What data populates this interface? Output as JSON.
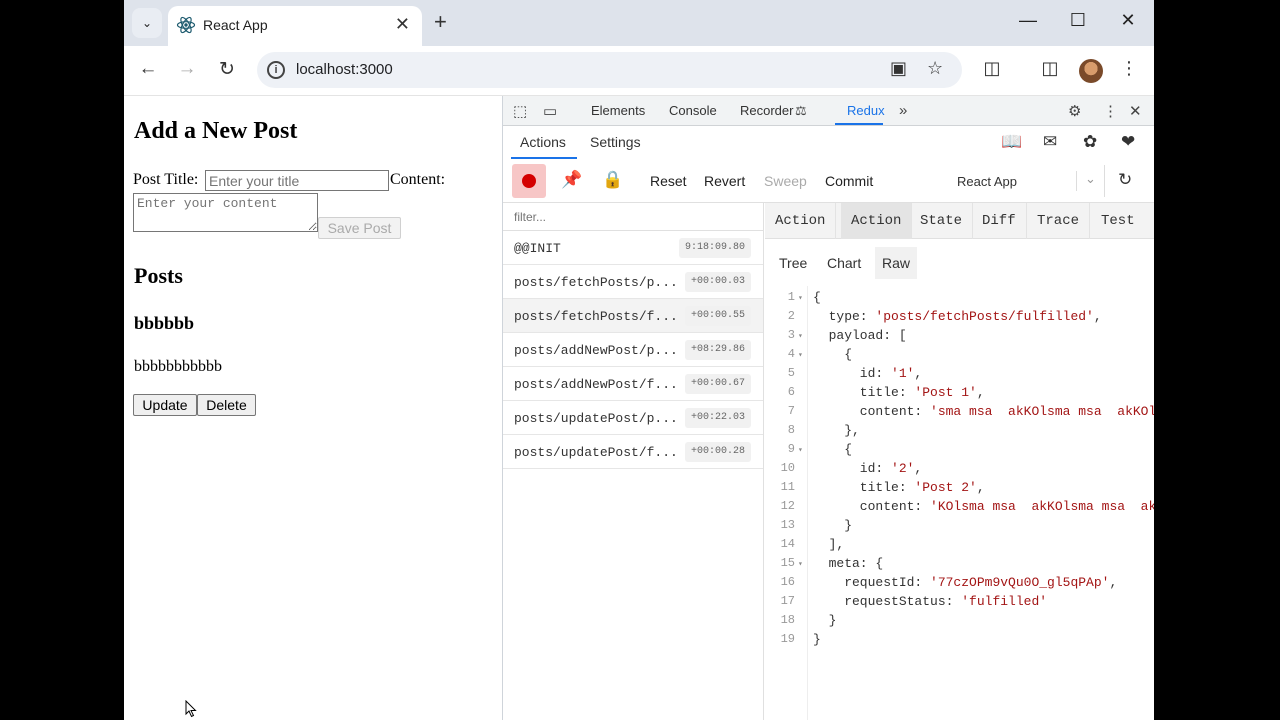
{
  "browser": {
    "tab_title": "React App",
    "url": "localhost:3000",
    "new_tab_glyph": "+",
    "close_tab_glyph": "✕"
  },
  "page": {
    "heading": "Add a New Post",
    "post_title_label": "Post Title:",
    "post_title_placeholder": "Enter your title",
    "content_label": "Content:",
    "content_placeholder": "Enter your content",
    "save_button": "Save Post",
    "posts_heading": "Posts",
    "posts": [
      {
        "title": "bbbbbb",
        "content": "bbbbbbbbbbb"
      }
    ],
    "update_button": "Update",
    "delete_button": "Delete"
  },
  "devtools": {
    "tabs": [
      "Elements",
      "Console",
      "Recorder",
      "Redux"
    ],
    "active_tab": "Redux"
  },
  "redux": {
    "subtabs": [
      "Actions",
      "Settings"
    ],
    "toolbar": {
      "reset": "Reset",
      "revert": "Revert",
      "sweep": "Sweep",
      "commit": "Commit",
      "instance": "React App"
    },
    "filter_placeholder": "filter...",
    "actions": [
      {
        "name": "@@INIT",
        "time": "9:18:09.80"
      },
      {
        "name": "posts/fetchPosts/p...",
        "time": "+00:00.03"
      },
      {
        "name": "posts/fetchPosts/f...",
        "time": "+00:00.55",
        "selected": true
      },
      {
        "name": "posts/addNewPost/p...",
        "time": "+08:29.86"
      },
      {
        "name": "posts/addNewPost/f...",
        "time": "+00:00.67"
      },
      {
        "name": "posts/updatePost/p...",
        "time": "+00:22.03"
      },
      {
        "name": "posts/updatePost/f...",
        "time": "+00:00.28"
      }
    ],
    "inspector_tabs": [
      "Action",
      "Action",
      "State",
      "Diff",
      "Trace",
      "Test"
    ],
    "active_inspector_tab": 1,
    "view_tabs": [
      "Tree",
      "Chart",
      "Raw"
    ],
    "active_view_tab": "Raw",
    "raw_lines": [
      "{",
      "  type: 'posts/fetchPosts/fulfilled',",
      "  payload: [",
      "    {",
      "      id: '1',",
      "      title: 'Post 1',",
      "      content: 'sma msa  akKOlsma msa  akKOlsma msa  akKOl",
      "    },",
      "    {",
      "      id: '2',",
      "      title: 'Post 2',",
      "      content: 'KOlsma msa  akKOlsma msa  akKOlsma msa",
      "    }",
      "  ],",
      "  meta: {",
      "    requestId: '77czOPm9vQu0O_gl5qPAp',",
      "    requestStatus: 'fulfilled'",
      "  }",
      "}"
    ],
    "fold_lines": [
      1,
      3,
      4,
      9,
      15
    ]
  },
  "colors": {
    "accent": "#1a73e8",
    "record": "#d40000",
    "string": "#a31515"
  }
}
